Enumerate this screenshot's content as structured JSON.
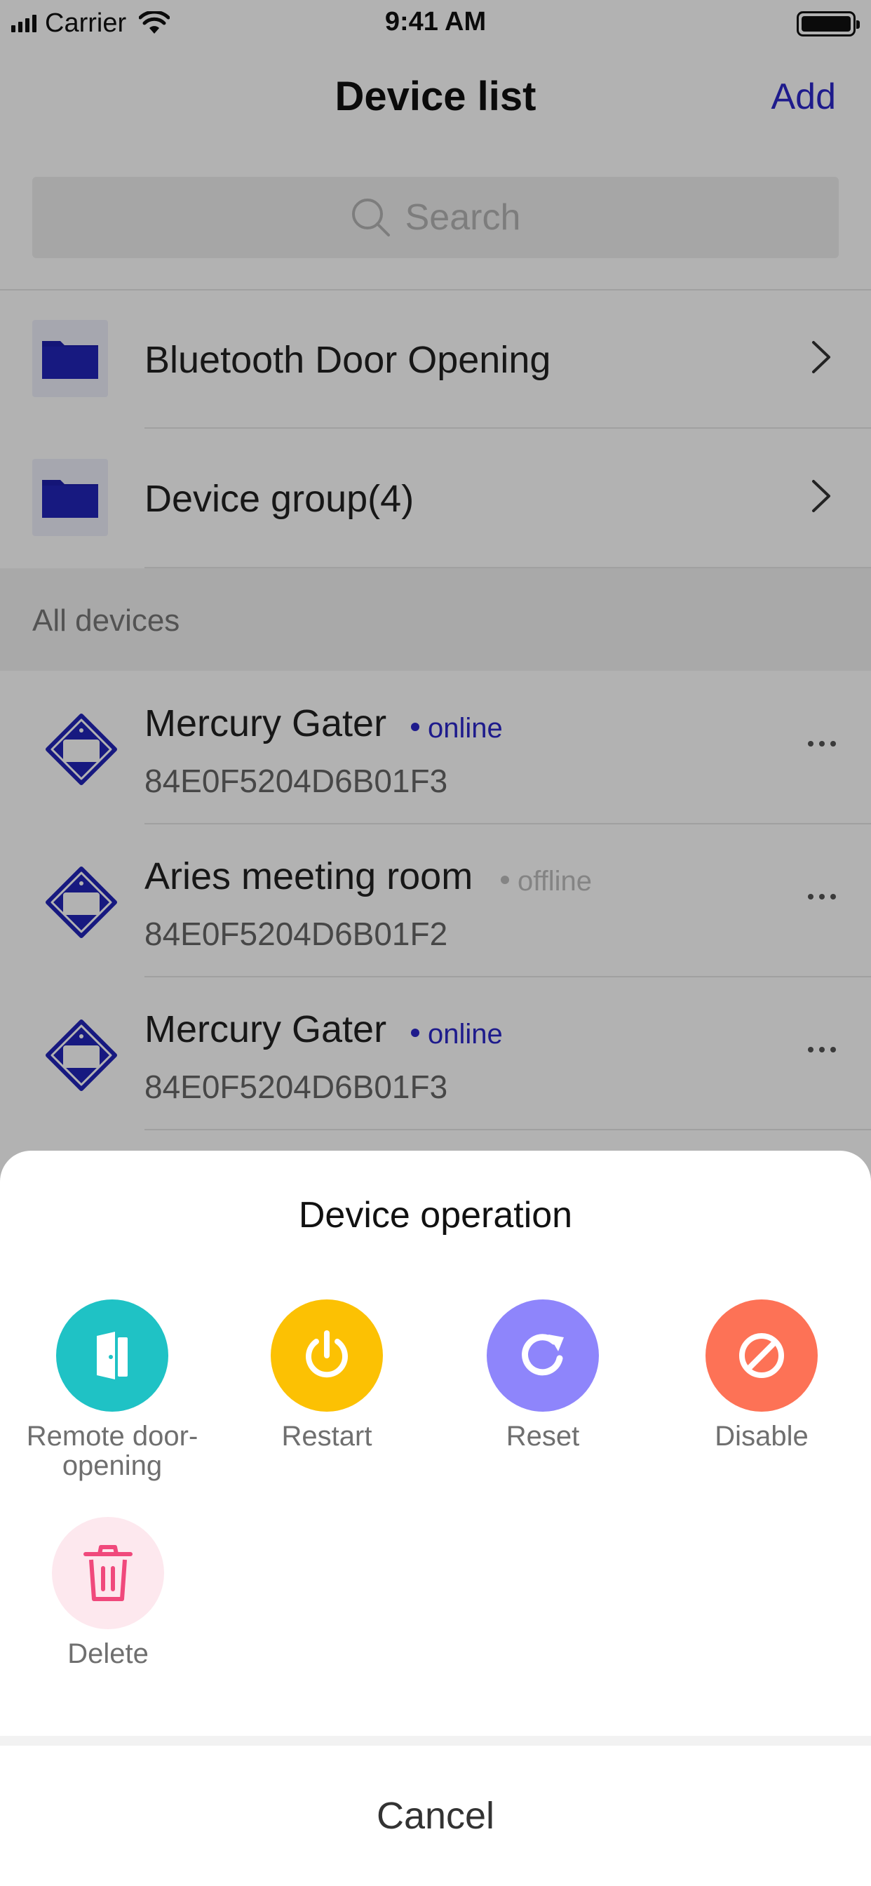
{
  "status_bar": {
    "carrier": "Carrier",
    "time": "9:41 AM"
  },
  "header": {
    "title": "Device list",
    "add_label": "Add"
  },
  "search": {
    "placeholder": "Search"
  },
  "groups": [
    {
      "label": "Bluetooth Door Opening"
    },
    {
      "label": "Device group(4)"
    }
  ],
  "section": {
    "title": "All devices"
  },
  "devices": [
    {
      "name": "Mercury Gater",
      "status": "online",
      "id": "84E0F5204D6B01F3"
    },
    {
      "name": "Aries meeting room",
      "status": "offline",
      "id": "84E0F5204D6B01F2"
    },
    {
      "name": "Mercury Gater",
      "status": "online",
      "id": "84E0F5204D6B01F3"
    }
  ],
  "sheet": {
    "title": "Device operation",
    "actions": [
      {
        "label": "Remote door-\nopening",
        "icon": "door-icon",
        "color": "#1fc2c5"
      },
      {
        "label": "Restart",
        "icon": "power-icon",
        "color": "#fcc103"
      },
      {
        "label": "Reset",
        "icon": "reset-icon",
        "color": "#8e85fb"
      },
      {
        "label": "Disable",
        "icon": "disable-icon",
        "color": "#fd7256"
      },
      {
        "label": "Delete",
        "icon": "trash-icon",
        "color": "#fde8ee"
      }
    ],
    "cancel_label": "Cancel"
  },
  "colors": {
    "accent": "#2b27c9",
    "online": "#2b27c9",
    "offline": "#bdbdbd"
  }
}
